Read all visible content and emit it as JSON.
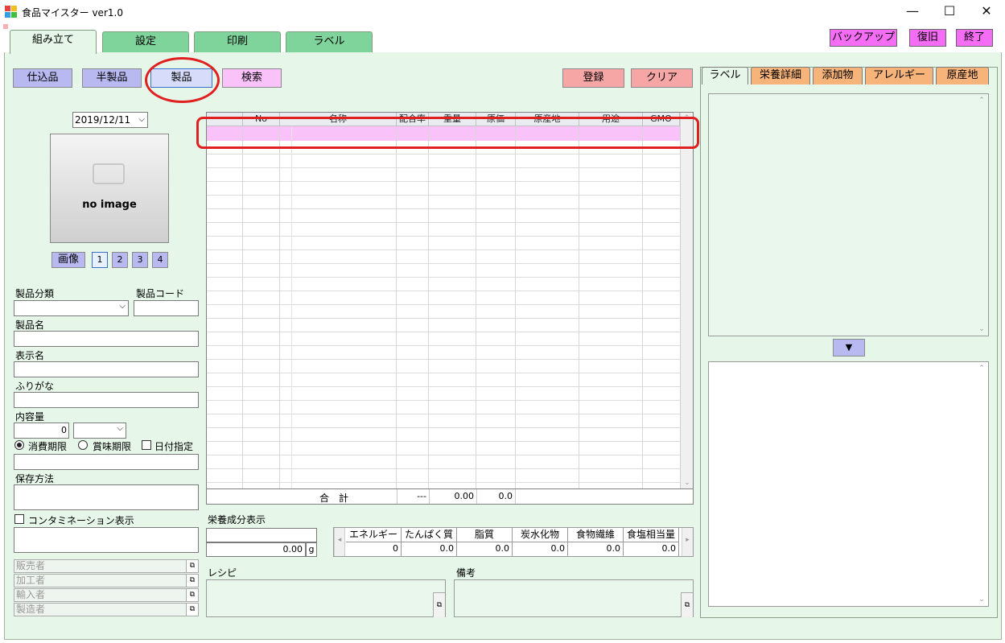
{
  "window": {
    "title": "食品マイスター ver1.0",
    "minimize": "—",
    "maximize": "☐",
    "close": "✕"
  },
  "tabs": [
    "組み立て",
    "設定",
    "印刷",
    "ラベル"
  ],
  "top_buttons": {
    "backup": "バックアップ",
    "restore": "復旧",
    "exit": "終了"
  },
  "mode_buttons": {
    "purchase": "仕込品",
    "semi": "半製品",
    "product": "製品",
    "search": "検索"
  },
  "action_buttons": {
    "register": "登録",
    "clear": "クリア"
  },
  "left": {
    "date": "2019/12/11",
    "no_image": "no image",
    "image_label": "画像",
    "image_pages": [
      "1",
      "2",
      "3",
      "4"
    ],
    "category_label": "製品分類",
    "code_label": "製品コード",
    "name_label": "製品名",
    "display_name_label": "表示名",
    "furigana_label": "ふりがな",
    "content_label": "内容量",
    "content_value": "0",
    "expiry_consume": "消費期限",
    "expiry_best": "賞味期限",
    "date_specify": "日付指定",
    "storage_label": "保存方法",
    "contamination_label": "コンタミネーション表示",
    "seller": "販売者",
    "processor": "加工者",
    "importer": "輸入者",
    "manufacturer": "製造者"
  },
  "grid": {
    "columns": [
      "No",
      "名称",
      "配合率",
      "重量",
      "原価",
      "原産地",
      "用途",
      "GMO"
    ],
    "total_label": "合　計",
    "total_dash": "---",
    "total_weight": "0.00",
    "total_cost": "0.0"
  },
  "nutrition": {
    "label": "栄養成分表示",
    "amount": "0.00",
    "unit": "g",
    "headers": [
      "エネルギー",
      "たんぱく質",
      "脂質",
      "炭水化物",
      "食物繊維",
      "食塩相当量"
    ],
    "values": [
      "0",
      "0.0",
      "0.0",
      "0.0",
      "0.0",
      "0.0"
    ]
  },
  "recipe_label": "レシピ",
  "notes_label": "備考",
  "right_tabs": [
    "ラベル",
    "栄養詳細",
    "添加物",
    "アレルギー",
    "原産地"
  ],
  "colors": {
    "pane_bg": "#e6f7e9",
    "tab_green": "#7fd49b",
    "highlight_row": "#f9c2f9",
    "annotation_red": "#e02020"
  }
}
